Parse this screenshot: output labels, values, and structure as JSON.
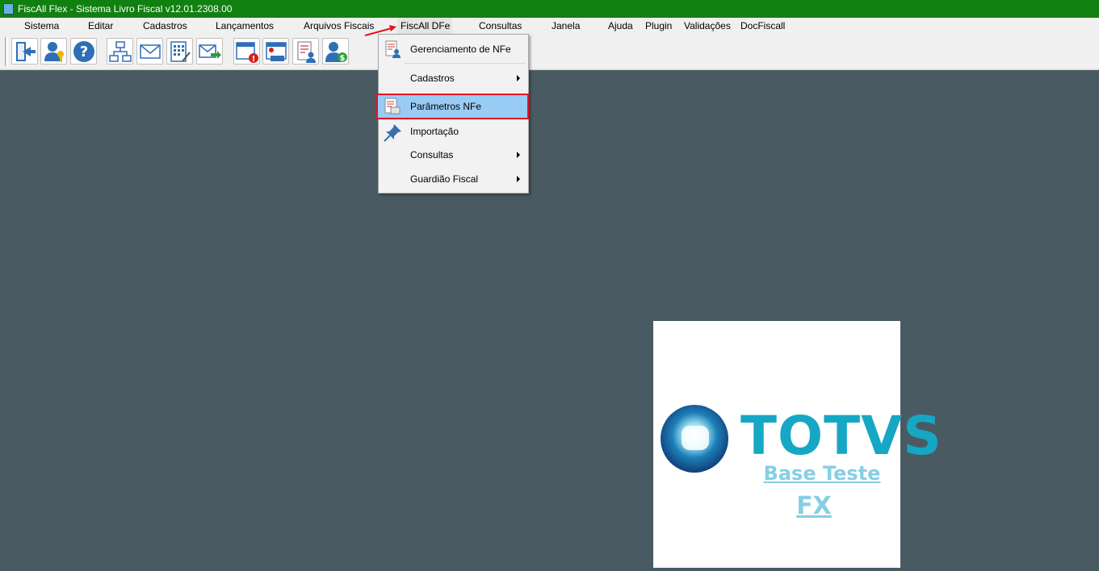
{
  "window": {
    "title": "FiscAll Flex - Sistema Livro Fiscal v12.01.2308.00",
    "titlebar_color": "#108010"
  },
  "menubar": {
    "items": [
      "Sistema",
      "Editar",
      "Cadastros",
      "Lançamentos",
      "Arquivos Fiscais",
      "FiscAll DFe",
      "Consultas",
      "Janela",
      "Ajuda",
      "Plugin",
      "Validações",
      "DocFiscall"
    ],
    "active": "FiscAll DFe"
  },
  "toolbar": {
    "buttons": [
      "exit-door-icon",
      "user-key-icon",
      "help-question-icon",
      "org-chart-icon",
      "envelope-icon",
      "calculator-document-icon",
      "send-mail-icon",
      "calendar-alert-icon",
      "icms-calendar-icon",
      "document-user-icon",
      "user-money-icon"
    ]
  },
  "dropdown": {
    "items": [
      {
        "label": "Gerenciamento de NFe",
        "icon": "document-user-icon",
        "submenu": false
      },
      {
        "label": "Cadastros",
        "icon": "",
        "submenu": true
      },
      {
        "label": "Parâmetros NFe",
        "icon": "document-settings-icon",
        "submenu": false,
        "highlighted": true
      },
      {
        "label": "Importação",
        "icon": "pin-icon",
        "submenu": false
      },
      {
        "label": "Consultas",
        "icon": "",
        "submenu": true
      },
      {
        "label": "Guardião Fiscal",
        "icon": "",
        "submenu": true
      }
    ],
    "highlight_color": "#99ccf5",
    "highlight_border": "#e81123"
  },
  "brand": {
    "logo_text": "TOTVS",
    "base_line1": "Base Teste",
    "base_line2": "FX",
    "logo_color": "#16a7c4",
    "link_color": "#86cfe3"
  },
  "desktop_color": "#4a5a63"
}
